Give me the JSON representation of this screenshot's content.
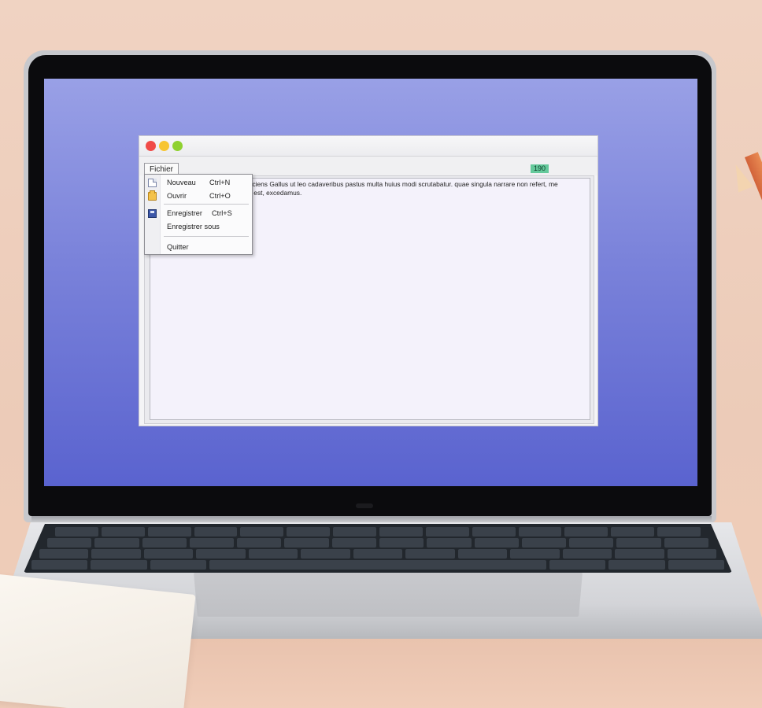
{
  "window": {
    "controls": [
      "close",
      "minimize",
      "maximize"
    ],
    "menu": {
      "fichier_label": "Fichier"
    },
    "counter": "190",
    "editor": {
      "text_line1": "rociens Gallus ut leo cadaveribus pastus multa huius modi scrutabatur. quae singula narrare non refert, me",
      "text_line2": "m est, excedamus."
    },
    "dropdown": {
      "items": [
        {
          "label": "Nouveau",
          "shortcut": "Ctrl+N",
          "icon": "new-document-icon"
        },
        {
          "label": "Ouvrir",
          "shortcut": "Ctrl+O",
          "icon": "open-folder-icon"
        },
        {
          "label": "Enregistrer",
          "shortcut": "Ctrl+S",
          "icon": "save-disk-icon"
        },
        {
          "label": "Enregistrer sous",
          "shortcut": "",
          "icon": ""
        },
        {
          "label": "Quitter",
          "shortcut": "",
          "icon": ""
        }
      ]
    }
  },
  "colors": {
    "desktop_top": "#99a0e6",
    "desktop_bottom": "#5a63cf",
    "counter_bg": "#64c99b",
    "close": "#f04b48",
    "minimize": "#f7c531",
    "maximize": "#8fd130"
  }
}
